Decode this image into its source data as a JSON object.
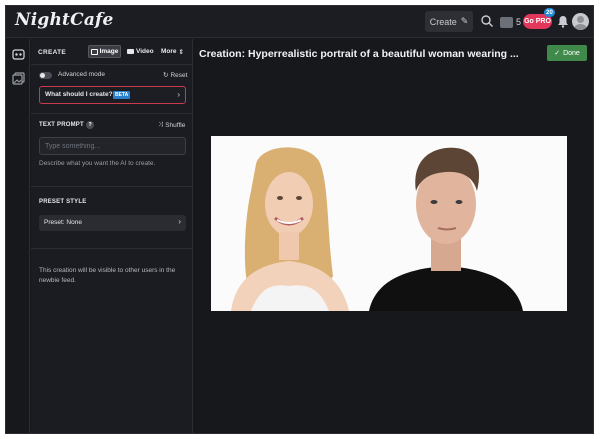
{
  "app": {
    "logo": "NightCafe"
  },
  "header": {
    "create_label": "Create",
    "credits": "5",
    "go_pro_label": "Go PRO",
    "pro_badge": "20"
  },
  "sidebar": {
    "title": "CREATE",
    "tabs": [
      "Image",
      "Video",
      "More"
    ],
    "advanced_mode_label": "Advanced mode",
    "reset_label": "Reset",
    "what_should_label": "What should I create?",
    "beta_label": "BETA",
    "text_prompt_title": "TEXT PROMPT",
    "help_glyph": "?",
    "shuffle_label": "Shuffle",
    "prompt_placeholder": "Type something...",
    "prompt_value": "",
    "prompt_help": "Describe what you want the AI to create.",
    "preset_title": "PRESET STYLE",
    "preset_value": "Preset: None",
    "visibility_note": "This creation will be visible to other users in the newbie feed."
  },
  "main": {
    "title": "Creation: Hyperrealistic portrait of a beautiful woman wearing ...",
    "done_label": "Done"
  },
  "colors": {
    "background": "#17181c",
    "accent_red": "#e2375a",
    "done_green": "#3f8a4b",
    "beta_blue": "#2a7fcf"
  }
}
